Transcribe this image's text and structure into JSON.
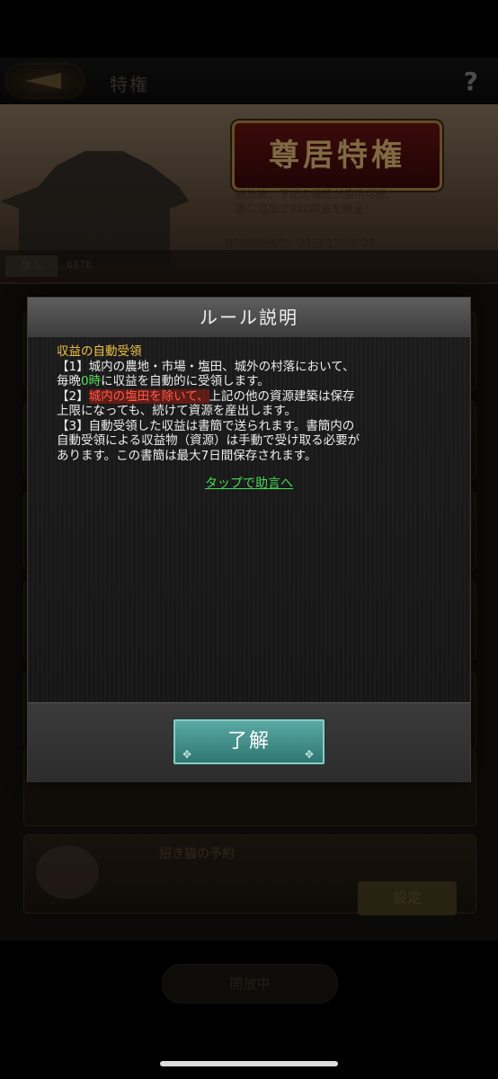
{
  "header": {
    "title": "特権"
  },
  "banner": {
    "emblem": "尊居特権",
    "desc_line1": "開放後、下記の機能が使用可能、",
    "desc_line2": "更に追加で980両金を贈呈！",
    "countdown": "有効期間残り：31日 12:20:07"
  },
  "buy_strip": {
    "buy_label": "購入",
    "coins": "6878"
  },
  "background": {
    "cat_card_title": "招き猫の予約",
    "set_button": "設定",
    "bottom_tab": "開放中"
  },
  "modal": {
    "title": "ルール説明",
    "heading": "収益の自動受領",
    "item1_line1": "【1】城内の農地・市場・塩田、城外の村落において、",
    "item1_line2_pre": "毎晩",
    "item1_line2_green": "0時",
    "item1_line2_post": "に収益を自動的に受領します。",
    "item2_pre": "【2】",
    "item2_red": "城内の塩田を除いて、",
    "item2_post": "上記の他の資源建築は保存",
    "item2_line2": "上限になっても、続けて資源を産出します。",
    "item3_line1": "【3】自動受領した収益は書簡で送られます。書簡内の",
    "item3_line2": "自動受領による収益物（資源）は手動で受け取る必要が",
    "item3_line3": "あります。この書簡は最大7日間保存されます。",
    "advice_link": "タップで助言へ",
    "ok_button": "了解"
  }
}
